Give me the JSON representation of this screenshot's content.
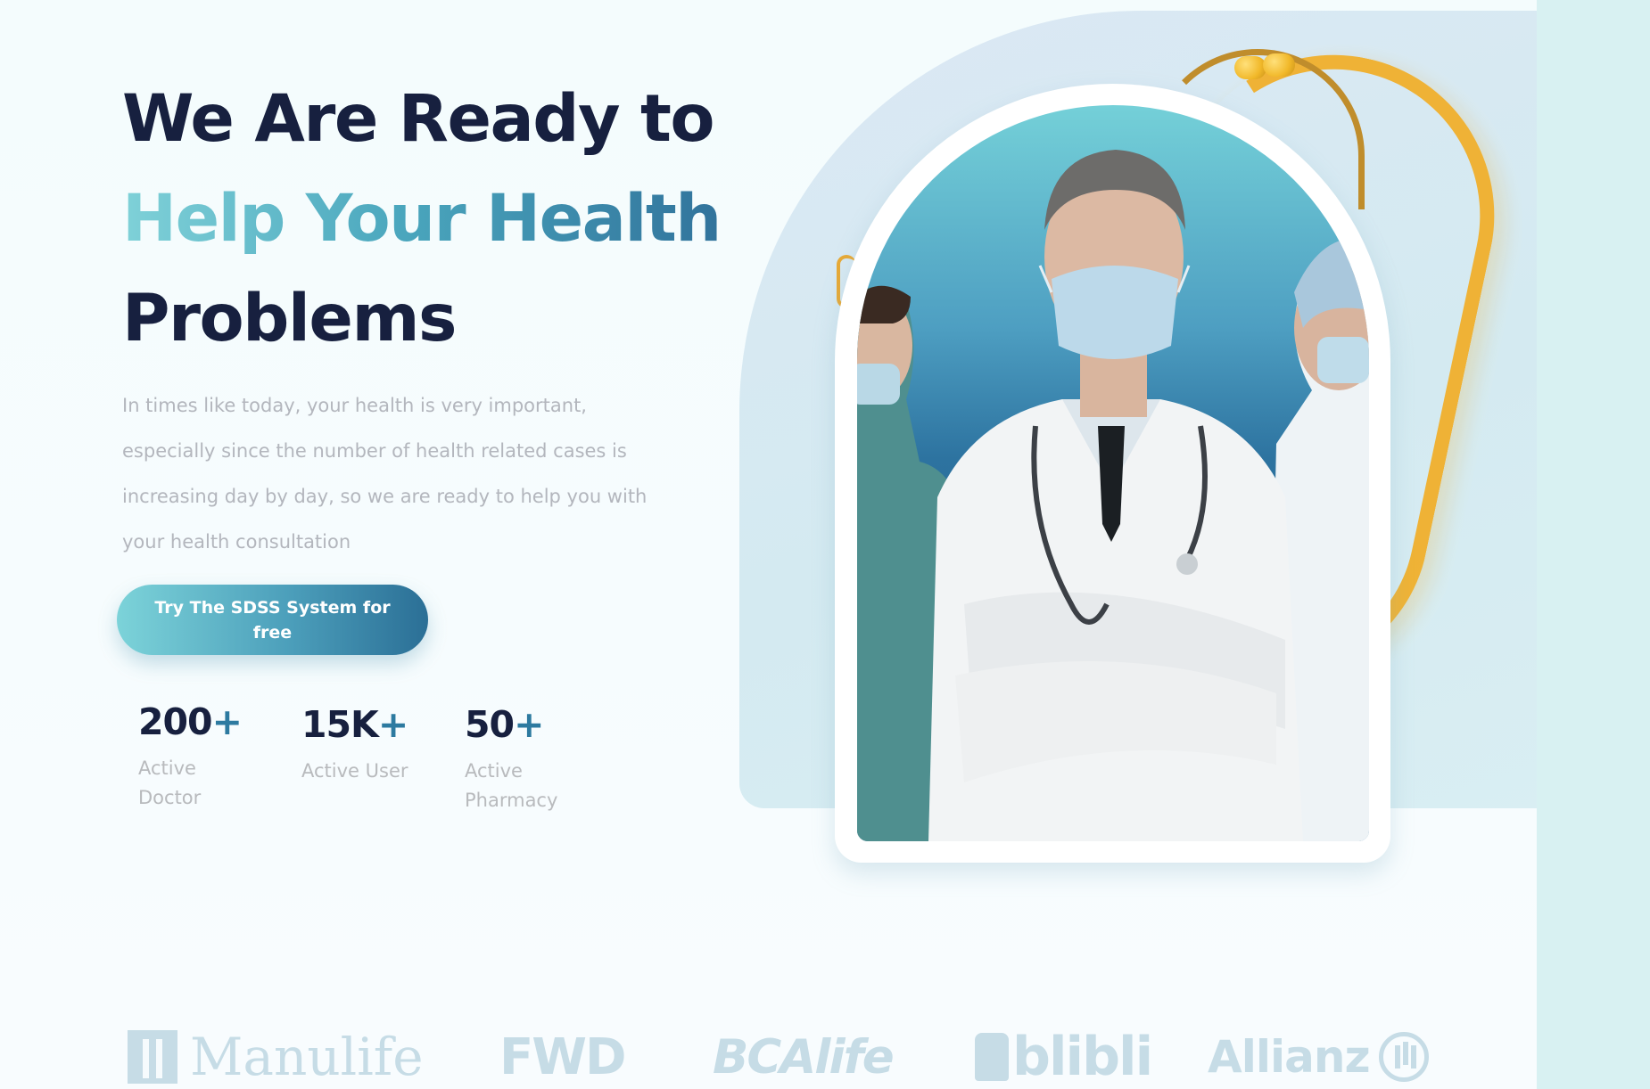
{
  "hero": {
    "headline_line1": "We Are Ready to",
    "headline_line2": "Help Your Health",
    "headline_line3": "Problems",
    "lead": "In times like today, your health is very important, especially since the number of health related cases is increasing day by day, so we are ready to help you with your health consultation",
    "cta_label": "Try The SDSS System for free"
  },
  "stats": [
    {
      "value": "200",
      "suffix": "+",
      "label": "Active Doctor"
    },
    {
      "value": "15K",
      "suffix": "+",
      "label": "Active User"
    },
    {
      "value": "50",
      "suffix": "+",
      "label": "Active Pharmacy"
    }
  ],
  "partners": [
    {
      "name": "Manulife",
      "icon": "manulife-logo-icon"
    },
    {
      "name": "FWD"
    },
    {
      "name": "BCAlife"
    },
    {
      "name": "blibli",
      "icon": "blibli-bag-icon"
    },
    {
      "name": "Allianz",
      "icon": "allianz-logo-icon"
    }
  ],
  "colors": {
    "heading": "#17203f",
    "accent_start": "#7fd1d8",
    "accent_end": "#2f6f99",
    "muted_text": "#b3b6bd",
    "plus": "#2d7aa0",
    "partner_logo": "#c6dce6"
  },
  "image": {
    "subject": "doctor-with-mask-and-nurses-photo"
  }
}
